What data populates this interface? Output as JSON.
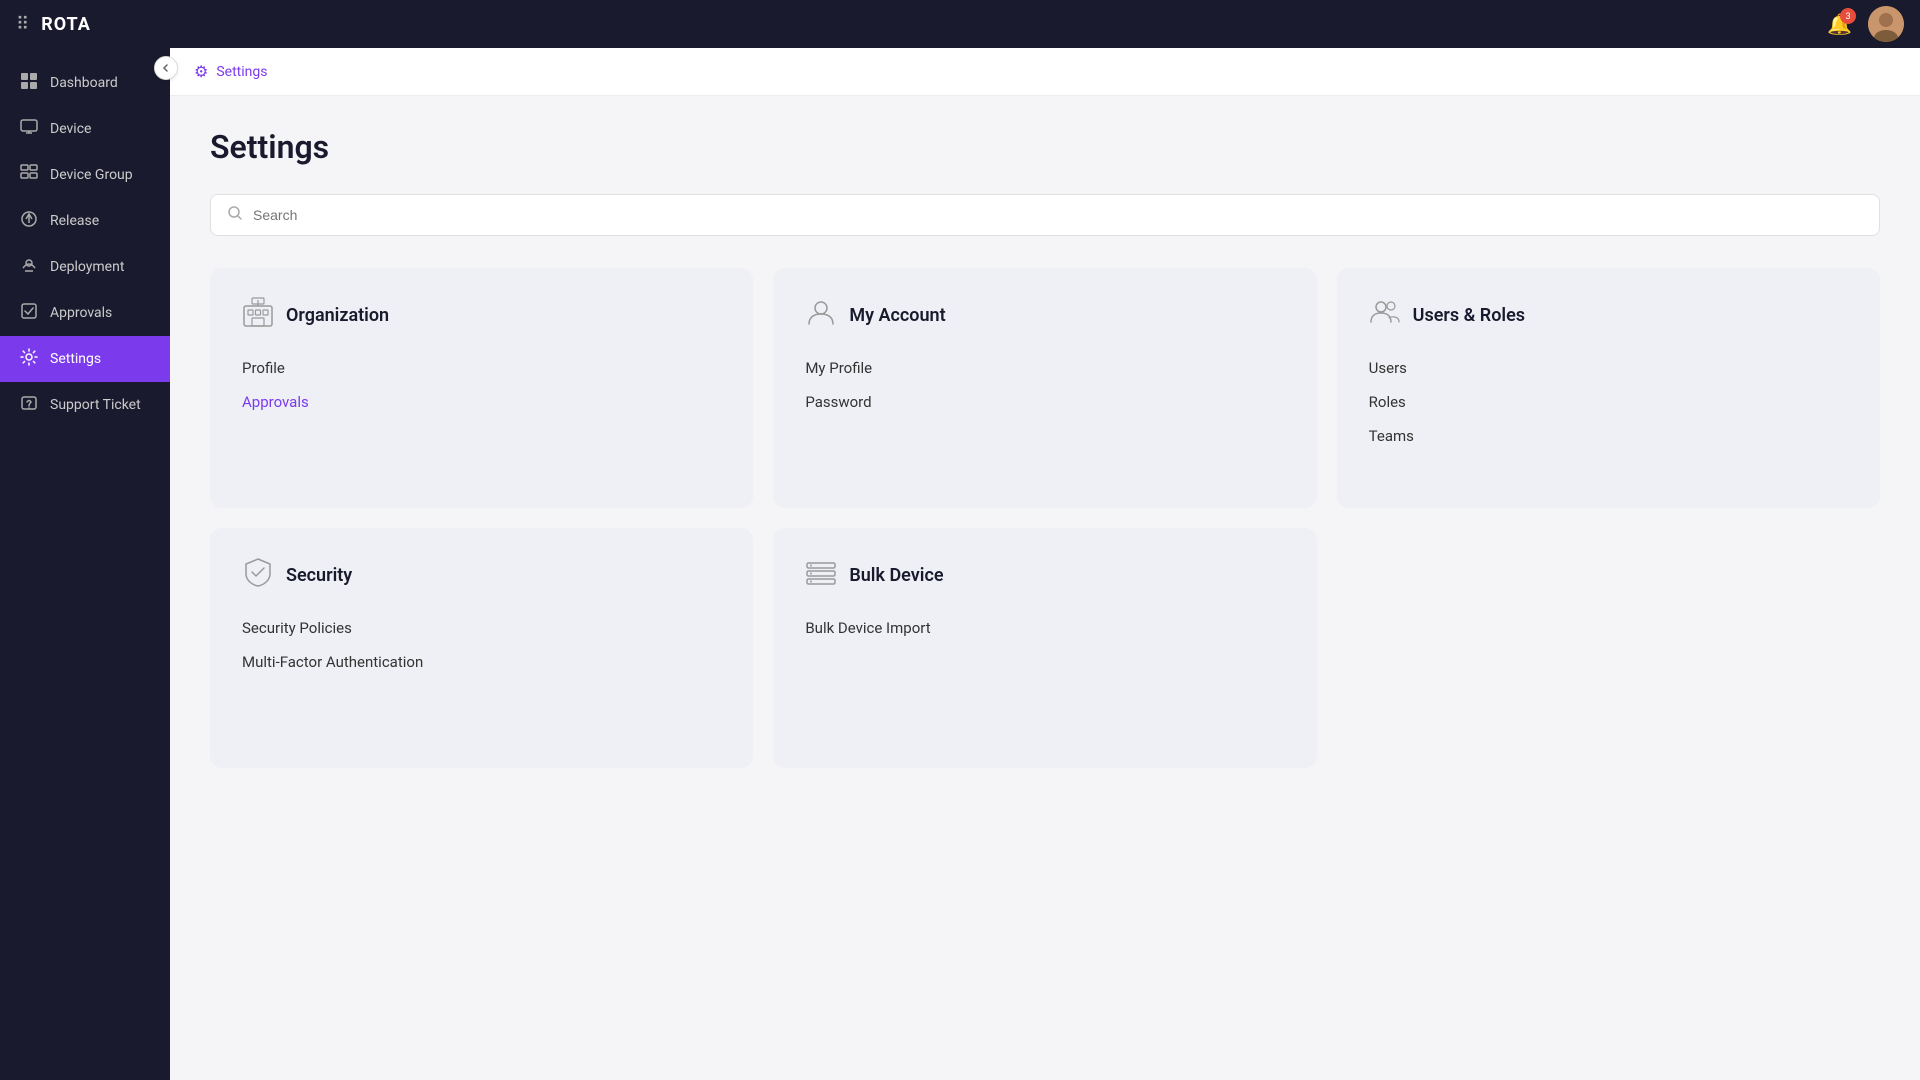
{
  "app": {
    "name": "ROTA"
  },
  "topbar": {
    "notifications_count": "3",
    "avatar_alt": "User Avatar"
  },
  "sidebar": {
    "items": [
      {
        "id": "dashboard",
        "label": "Dashboard",
        "icon": "⊞",
        "active": false
      },
      {
        "id": "device",
        "label": "Device",
        "icon": "💻",
        "active": false
      },
      {
        "id": "device-group",
        "label": "Device Group",
        "icon": "▦",
        "active": false
      },
      {
        "id": "release",
        "label": "Release",
        "icon": "🚀",
        "active": false
      },
      {
        "id": "deployment",
        "label": "Deployment",
        "icon": "☁",
        "active": false
      },
      {
        "id": "approvals",
        "label": "Approvals",
        "icon": "✅",
        "active": false
      },
      {
        "id": "settings",
        "label": "Settings",
        "icon": "⚙",
        "active": true
      },
      {
        "id": "support-ticket",
        "label": "Support Ticket",
        "icon": "🎫",
        "active": false
      }
    ]
  },
  "breadcrumb": {
    "icon": "⚙",
    "text": "Settings"
  },
  "page": {
    "title": "Settings",
    "search_placeholder": "Search"
  },
  "cards": [
    {
      "id": "organization",
      "title": "Organization",
      "icon": "🏢",
      "links": [
        {
          "id": "profile",
          "label": "Profile",
          "active": false
        },
        {
          "id": "approvals",
          "label": "Approvals",
          "active": true
        }
      ]
    },
    {
      "id": "my-account",
      "title": "My Account",
      "icon": "👤",
      "links": [
        {
          "id": "my-profile",
          "label": "My Profile",
          "active": false
        },
        {
          "id": "password",
          "label": "Password",
          "active": false
        }
      ]
    },
    {
      "id": "users-roles",
      "title": "Users & Roles",
      "icon": "👥",
      "links": [
        {
          "id": "users",
          "label": "Users",
          "active": false
        },
        {
          "id": "roles",
          "label": "Roles",
          "active": false
        },
        {
          "id": "teams",
          "label": "Teams",
          "active": false
        }
      ]
    },
    {
      "id": "security",
      "title": "Security",
      "icon": "🛡",
      "links": [
        {
          "id": "security-policies",
          "label": "Security Policies",
          "active": false
        },
        {
          "id": "mfa",
          "label": "Multi-Factor Authentication",
          "active": false
        }
      ]
    },
    {
      "id": "bulk-device",
      "title": "Bulk Device",
      "icon": "🗄",
      "links": [
        {
          "id": "bulk-device-import",
          "label": "Bulk Device Import",
          "active": false
        }
      ]
    }
  ]
}
